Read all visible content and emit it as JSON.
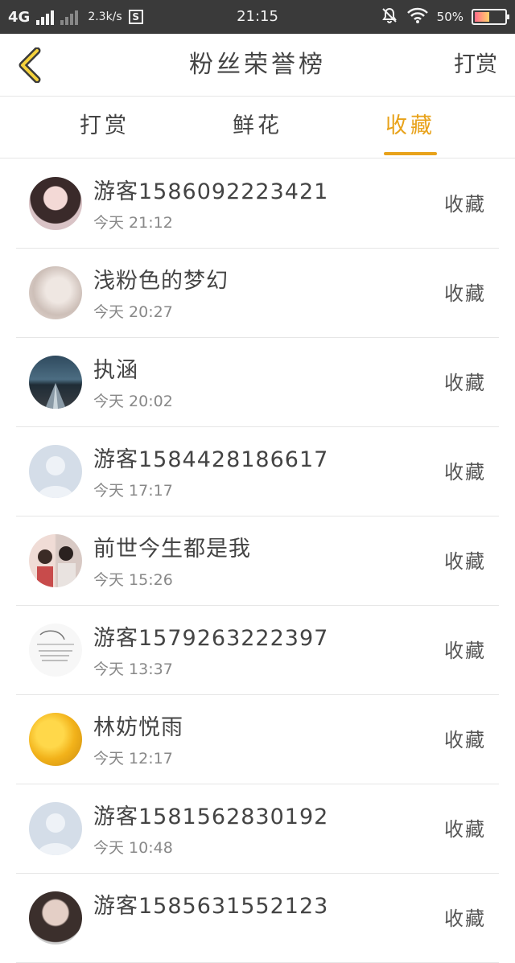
{
  "status_bar": {
    "network": "4G",
    "speed": "2.3k/s",
    "s_badge": "S",
    "time": "21:15",
    "battery_pct": "50%",
    "battery_level": 0.5
  },
  "nav": {
    "title": "粉丝荣誉榜",
    "right_label": "打赏",
    "back_icon": "chevron-left-icon",
    "accent_color": "#e8a21a"
  },
  "tabs": [
    {
      "label": "打赏",
      "active": false
    },
    {
      "label": "鲜花",
      "active": false
    },
    {
      "label": "收藏",
      "active": true
    }
  ],
  "list": [
    {
      "name": "游客1586092223421",
      "time": "今天 21:12",
      "action": "收藏",
      "avatar": "photo-girl"
    },
    {
      "name": "浅粉色的梦幻",
      "time": "今天 20:27",
      "action": "收藏",
      "avatar": "photo-pale"
    },
    {
      "name": "执涵",
      "time": "今天 20:02",
      "action": "收藏",
      "avatar": "photo-road"
    },
    {
      "name": "游客1584428186617",
      "time": "今天 17:17",
      "action": "收藏",
      "avatar": "default"
    },
    {
      "name": "前世今生都是我",
      "time": "今天 15:26",
      "action": "收藏",
      "avatar": "photo-couple"
    },
    {
      "name": "游客1579263222397",
      "time": "今天 13:37",
      "action": "收藏",
      "avatar": "sketch"
    },
    {
      "name": "林妨悦雨",
      "time": "今天 12:17",
      "action": "收藏",
      "avatar": "photo-flowers"
    },
    {
      "name": "游客1581562830192",
      "time": "今天 10:48",
      "action": "收藏",
      "avatar": "default"
    },
    {
      "name": "游客1585631552123",
      "time": "",
      "action": "收藏",
      "avatar": "photo-partial"
    }
  ]
}
